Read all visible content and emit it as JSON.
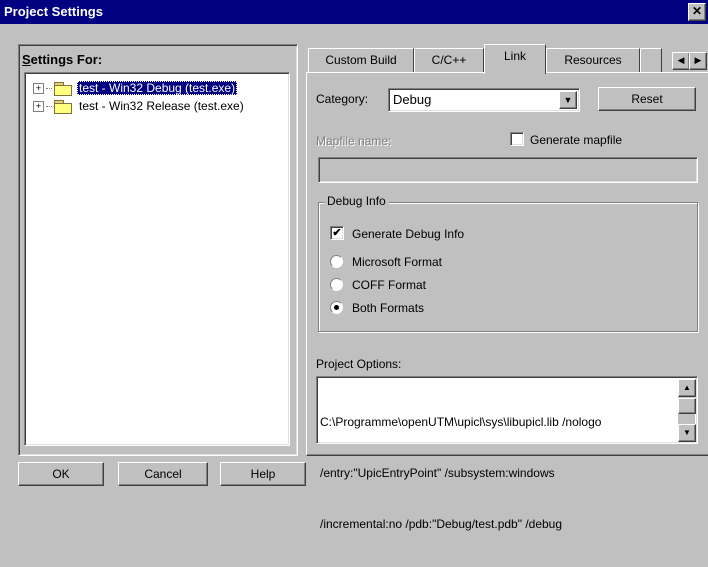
{
  "window": {
    "title": "Project Settings",
    "close_glyph": "✕"
  },
  "left": {
    "settings_for_label": "Settings For:",
    "tree_items": [
      {
        "label": "test - Win32 Debug (test.exe)",
        "selected": true
      },
      {
        "label": "test - Win32 Release (test.exe)",
        "selected": false
      }
    ]
  },
  "tabs": [
    {
      "label": "Custom Build",
      "active": false
    },
    {
      "label": "C/C++",
      "active": false
    },
    {
      "label": "Link",
      "active": true
    },
    {
      "label": "Resources",
      "active": false
    }
  ],
  "tab_scroll": {
    "left_glyph": "◀",
    "right_glyph": "▶"
  },
  "link": {
    "category_label": "Category:",
    "category_value": "Debug",
    "reset_label": "Reset",
    "mapfile_label": "Mapfile name:",
    "mapfile_value": "",
    "generate_mapfile_label": "Generate mapfile",
    "generate_mapfile_checked": false,
    "debug_info": {
      "title": "Debug Info",
      "generate_debug_info_label": "Generate Debug Info",
      "generate_debug_info_checked": true,
      "formats": [
        {
          "label": "Microsoft Format",
          "selected": false
        },
        {
          "label": "COFF Format",
          "selected": false
        },
        {
          "label": "Both Formats",
          "selected": true
        }
      ]
    },
    "project_options_label": "Project Options:",
    "project_options_lines": [
      "C:\\Programme\\openUTM\\upicl\\sys\\libupicl.lib /nologo",
      "/entry:\"UpicEntryPoint\" /subsystem:windows",
      "/incremental:no /pdb:\"Debug/test.pdb\" /debug"
    ]
  },
  "footer": {
    "ok": "OK",
    "cancel": "Cancel",
    "help": "Help"
  },
  "glyphs": {
    "check": "✔",
    "dropdown": "▼",
    "scroll_up": "▲",
    "scroll_down": "▼",
    "expand": "+"
  }
}
